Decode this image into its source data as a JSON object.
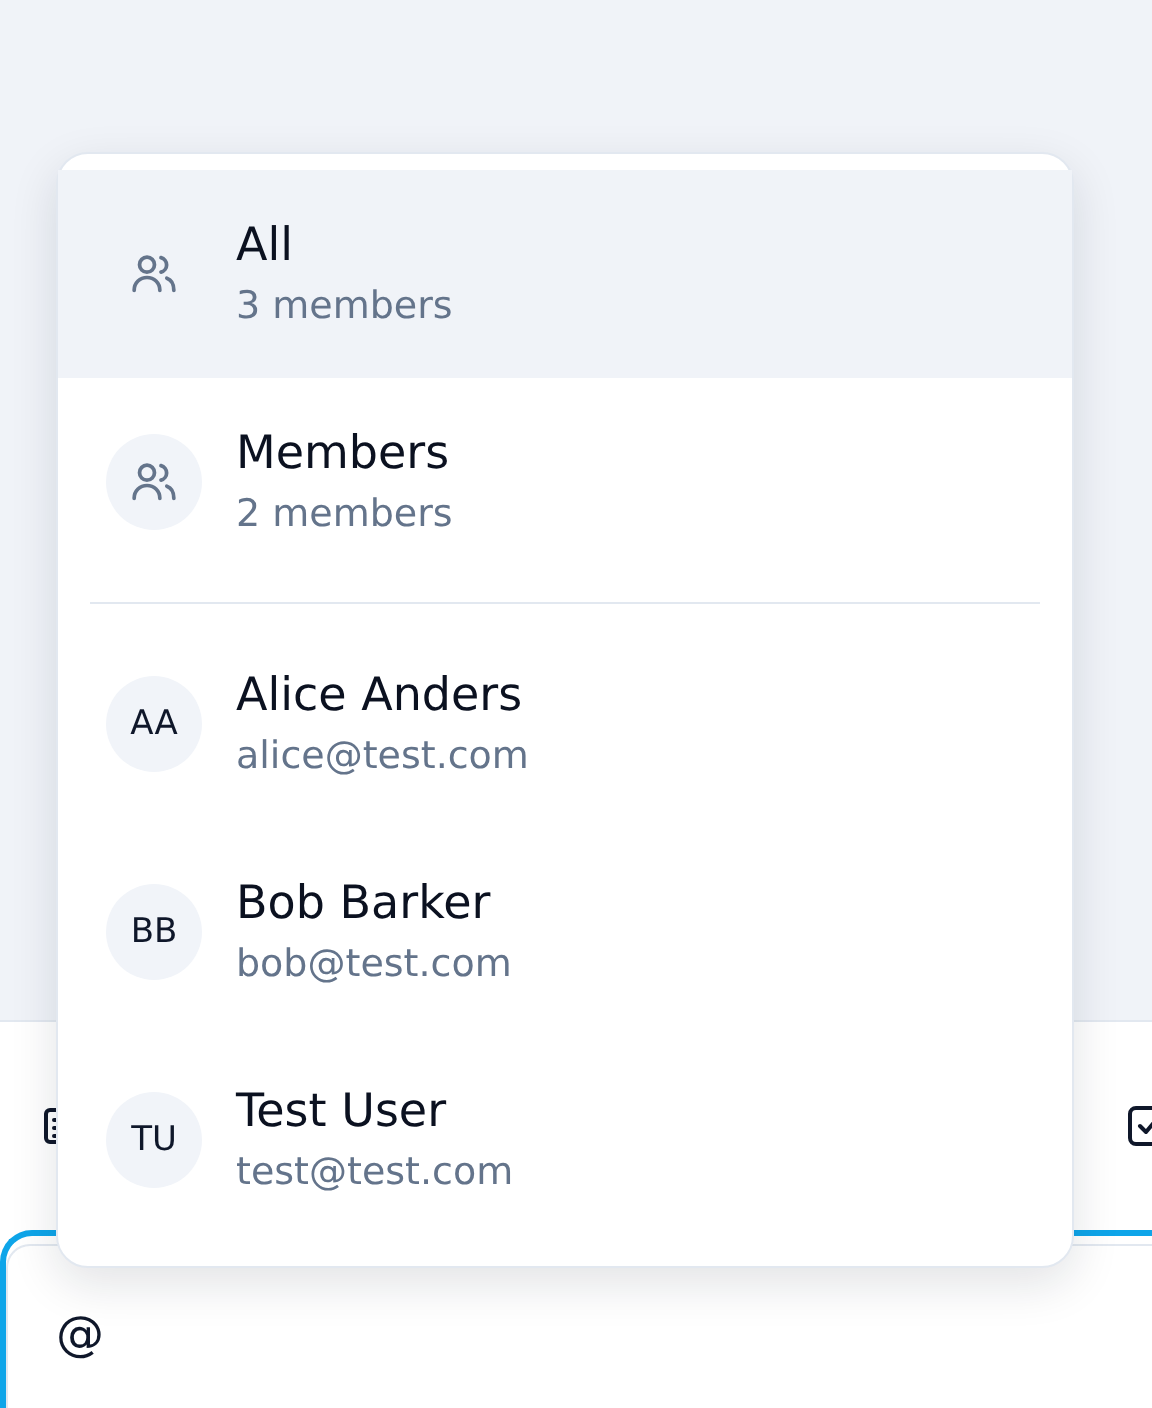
{
  "mention_menu": {
    "items": [
      {
        "kind": "group",
        "name": "All",
        "detail": "3 members",
        "selected": true
      },
      {
        "kind": "group",
        "name": "Members",
        "detail": "2 members",
        "selected": false
      },
      {
        "kind": "divider"
      },
      {
        "kind": "user",
        "initials": "AA",
        "name": "Alice Anders",
        "detail": "alice@test.com",
        "selected": false
      },
      {
        "kind": "user",
        "initials": "BB",
        "name": "Bob Barker",
        "detail": "bob@test.com",
        "selected": false
      },
      {
        "kind": "user",
        "initials": "TU",
        "name": "Test User",
        "detail": "test@test.com",
        "selected": false
      }
    ]
  },
  "message_field": {
    "value": "@"
  }
}
